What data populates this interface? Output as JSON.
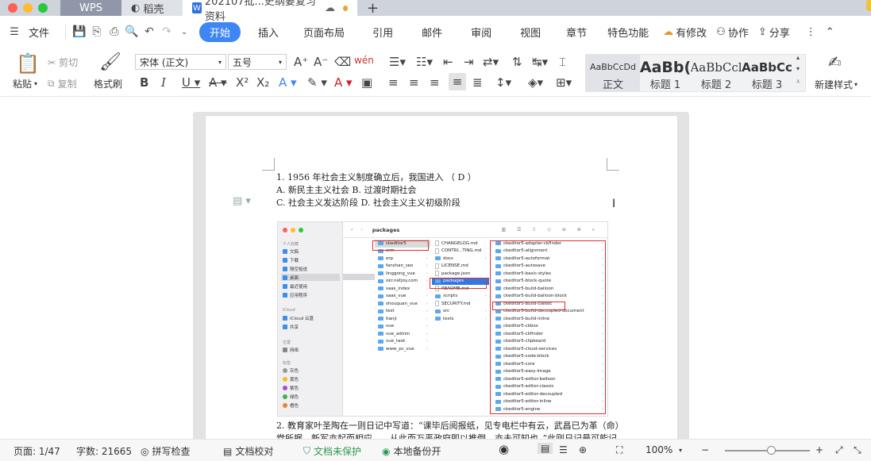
{
  "titlebar": {
    "tabs": [
      {
        "label": "WPS"
      },
      {
        "label": "稻壳"
      },
      {
        "label": "202107批...史纲要复习资料"
      }
    ],
    "new_tab": "+"
  },
  "menubar": {
    "file": "文件",
    "start": "开始",
    "items": [
      "插入",
      "页面布局",
      "引用",
      "邮件",
      "审阅",
      "视图",
      "章节",
      "特色功能"
    ],
    "modified": "有修改",
    "collab": "协作",
    "share": "分享"
  },
  "ribbon": {
    "paste": "粘贴",
    "cut": "剪切",
    "copy": "复制",
    "format_painter": "格式刷",
    "font_name": "宋体 (正文)",
    "font_size": "五号",
    "styles": [
      {
        "preview": "AaBbCcDd",
        "name": "正文"
      },
      {
        "preview": "AaBb(",
        "name": "标题 1"
      },
      {
        "preview": "AaBbCcl",
        "name": "标题 2"
      },
      {
        "preview": "AaBbCc",
        "name": "标题 3"
      }
    ],
    "new_style": "新建样式"
  },
  "document": {
    "q1_line1": "1.    1956 年社会主义制度确立后，我国进入  （  D  ）",
    "q1_line2": "A.  新民主主义社会      B.  过渡时期社会",
    "q1_line3": "C.  社会主义发达阶段  D.  社会主义主义初级阶段",
    "q2_line1": "2.     教育家叶圣陶在一则日记中写道：“课毕后阅报纸，见专电栏中有云，武昌已为革（命）",
    "q2_line2": "党所据。新军亦起而相应……从此而万恶政府即以推倒，亦未可知也。”此则日记最可能记"
  },
  "finder": {
    "title": "packages",
    "sidebar_sections": [
      "个人收藏",
      "iCloud",
      "位置",
      "标签"
    ],
    "favorites": [
      "文稿",
      "下载",
      "隔空投送",
      "桌面",
      "最近使用",
      "应用程序"
    ],
    "icloud": [
      "iCloud 云盘",
      "共享"
    ],
    "locations": [
      "网络"
    ],
    "tags": [
      "灰色",
      "黄色",
      "紫色",
      "绿色",
      "橙色"
    ],
    "col1": [
      "ckeditor5",
      "crm",
      "erp",
      "fanshan_seo",
      "linggong_vue",
      "okr.netjoy.com",
      "saas_index",
      "saas_vue",
      "shouquan_vue",
      "test",
      "tianji",
      "vue",
      "vue_admin",
      "vue_task",
      "www_pc_vue"
    ],
    "col2": [
      "CHANGELOG.md",
      "CONTRI...TING.md",
      "docs",
      "LICENSE.md",
      "package.json",
      "packages",
      "README.md",
      "scripts",
      "SECURITY.md",
      "src",
      "tests"
    ],
    "col3": [
      "ckeditor5-adapter-ckfinder",
      "ckeditor5-alignment",
      "ckeditor5-autoformat",
      "ckeditor5-autosave",
      "ckeditor5-basic-styles",
      "ckeditor5-block-quote",
      "ckeditor5-build-balloon",
      "ckeditor5-build-balloon-block",
      "ckeditor5-build-classic",
      "ckeditor5-build-decoupled-document",
      "ckeditor5-build-inline",
      "ckeditor5-ckbox",
      "ckeditor5-ckfinder",
      "ckeditor5-clipboard",
      "ckeditor5-cloud-services",
      "ckeditor5-code-block",
      "ckeditor5-core",
      "ckeditor5-easy-image",
      "ckeditor5-editor-balloon",
      "ckeditor5-editor-classic",
      "ckeditor5-editor-decoupled",
      "ckeditor5-editor-inline",
      "ckeditor5-engine"
    ]
  },
  "statusbar": {
    "page": "页面: 1/47",
    "words": "字数: 21665",
    "spell": "拼写检查",
    "proof": "文档校对",
    "protect": "文档未保护",
    "backup": "本地备份开",
    "zoom": "100%"
  },
  "colors": {
    "accent": "#3f86f5",
    "red_box": "#e03030",
    "protect_green": "#2e9a4f"
  }
}
